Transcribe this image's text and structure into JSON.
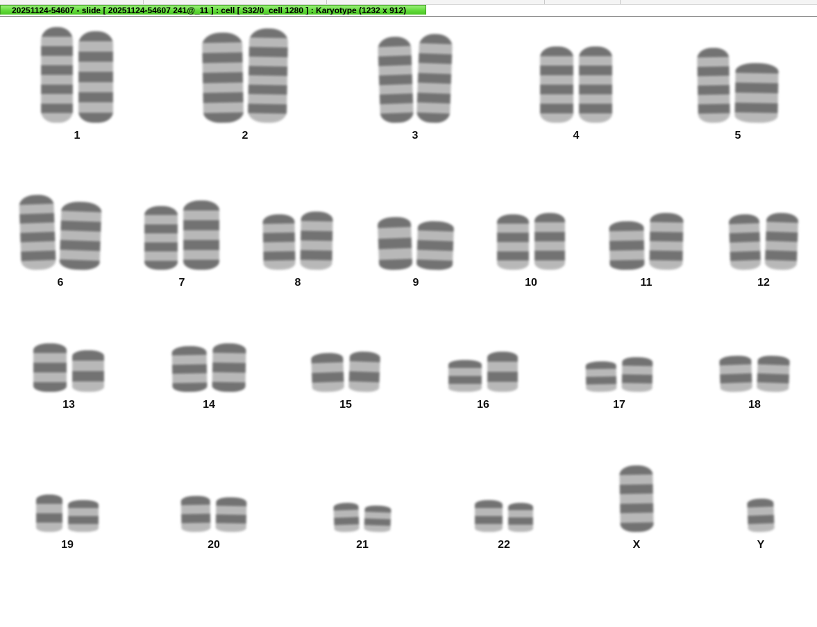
{
  "window": {
    "title": "20251124-54607 - slide [ 20251124-54607 241@_11 ] : cell [ S32/0_cell 1280 ] : Karyotype  (1232 x 912)"
  },
  "karyotype": {
    "chromosomes": [
      {
        "label": "1"
      },
      {
        "label": "2"
      },
      {
        "label": "3"
      },
      {
        "label": "4"
      },
      {
        "label": "5"
      },
      {
        "label": "6"
      },
      {
        "label": "7"
      },
      {
        "label": "8"
      },
      {
        "label": "9"
      },
      {
        "label": "10"
      },
      {
        "label": "11"
      },
      {
        "label": "12"
      },
      {
        "label": "13"
      },
      {
        "label": "14"
      },
      {
        "label": "15"
      },
      {
        "label": "16"
      },
      {
        "label": "17"
      },
      {
        "label": "18"
      },
      {
        "label": "19"
      },
      {
        "label": "20"
      },
      {
        "label": "21"
      },
      {
        "label": "22"
      },
      {
        "label": "X"
      },
      {
        "label": "Y"
      }
    ]
  },
  "colors": {
    "title_tab": "#5ed836",
    "chromosome": "#5a5a5a",
    "background": "#ffffff"
  }
}
